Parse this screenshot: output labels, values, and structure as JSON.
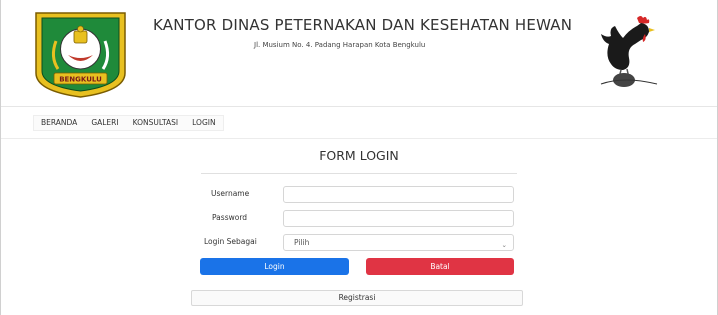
{
  "header": {
    "title": "KANTOR DINAS PETERNAKAN DAN KESEHATAN HEWAN",
    "address": "Jl. Musium No. 4. Padang Harapan Kota Bengkulu",
    "emblem_text": "BENGKULU"
  },
  "nav": {
    "items": [
      {
        "label": "BERANDA"
      },
      {
        "label": "GALERI"
      },
      {
        "label": "KONSULTASI"
      },
      {
        "label": "LOGIN"
      }
    ]
  },
  "form": {
    "title": "FORM LOGIN",
    "username_label": "Username",
    "username_value": "",
    "password_label": "Password",
    "password_value": "",
    "role_label": "Login Sebagai",
    "role_selected": "Pilih",
    "login_button": "Login",
    "cancel_button": "Batal",
    "register_button": "Registrasi"
  },
  "colors": {
    "login_button": "#1a73e8",
    "cancel_button": "#e03444"
  },
  "icons": [
    "emblem-logo",
    "rooster-logo",
    "chevron-down-icon"
  ]
}
